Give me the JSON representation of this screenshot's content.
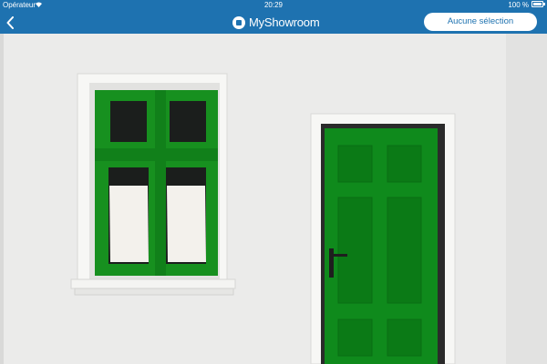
{
  "status_bar": {
    "carrier": "Opérateur",
    "time": "20:29",
    "battery": "100 %",
    "battery_level": 1.0
  },
  "nav_bar": {
    "back_icon": "chevron-left-icon",
    "brand_name": "MyShowroom",
    "brand_icon": "myshowroom-logo-icon",
    "select_label": "Aucune sélection"
  },
  "photo": {
    "window_frame_color": "#17901f",
    "door_color": "#0f8a1c",
    "wall_color": "#ebebea",
    "curtain_color": "#f3f1ec"
  },
  "colors": {
    "nav_bar": "#1e72b0",
    "button_text": "#1e72b0"
  }
}
